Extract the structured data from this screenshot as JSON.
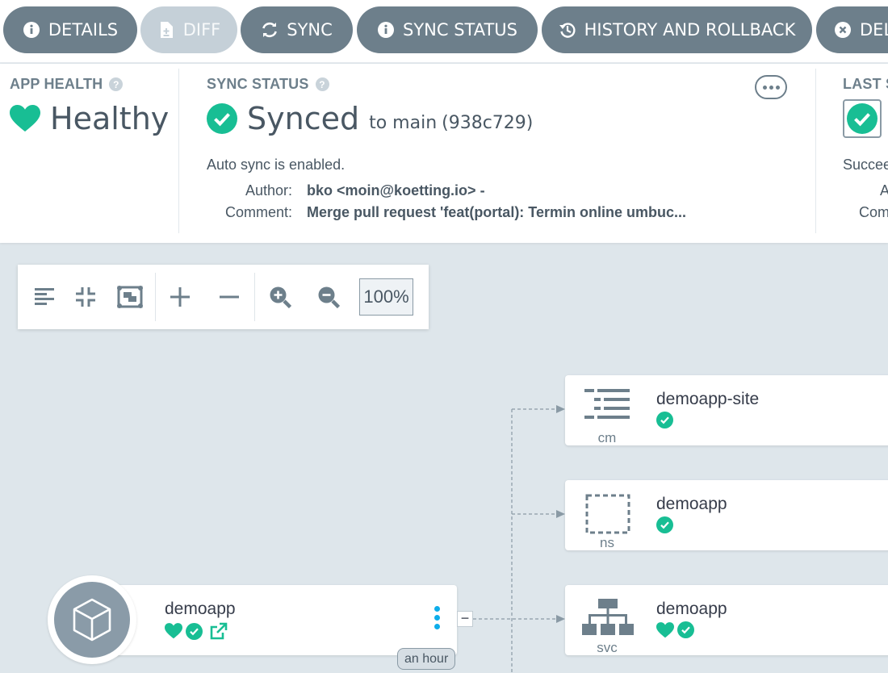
{
  "toolbar": {
    "details": "DETAILS",
    "diff": "DIFF",
    "sync": "SYNC",
    "sync_status": "SYNC STATUS",
    "history": "HISTORY AND ROLLBACK",
    "delete": "DELETE"
  },
  "app_health": {
    "title": "APP HEALTH",
    "status": "Healthy"
  },
  "sync_status": {
    "title": "SYNC STATUS",
    "status": "Synced",
    "target_prefix": "to main",
    "revision": "(938c729)",
    "auto_sync": "Auto sync is enabled.",
    "author_label": "Author:",
    "author_value": "bko <moin@koetting.io> -",
    "comment_label": "Comment:",
    "comment_value": "Merge pull request 'feat(portal): Termin online umbuc..."
  },
  "last_sync": {
    "title": "LAST SYNC",
    "status_partial": "Succeeded",
    "author_label_partial": "Author:",
    "comment_label_partial": "Comment:"
  },
  "graph_toolbar": {
    "zoom": "100%"
  },
  "nodes": {
    "configmap": {
      "name": "demoapp-site",
      "kind": "cm"
    },
    "namespace": {
      "name": "demoapp",
      "kind": "ns"
    },
    "service": {
      "name": "demoapp",
      "kind": "svc"
    },
    "application": {
      "name": "demoapp",
      "age": "an hour"
    }
  },
  "colors": {
    "healthy": "#18be94",
    "button": "#6d7f8b",
    "button_disabled": "#c5d0d8",
    "canvas": "#dee6eb",
    "link": "#0dadea"
  }
}
